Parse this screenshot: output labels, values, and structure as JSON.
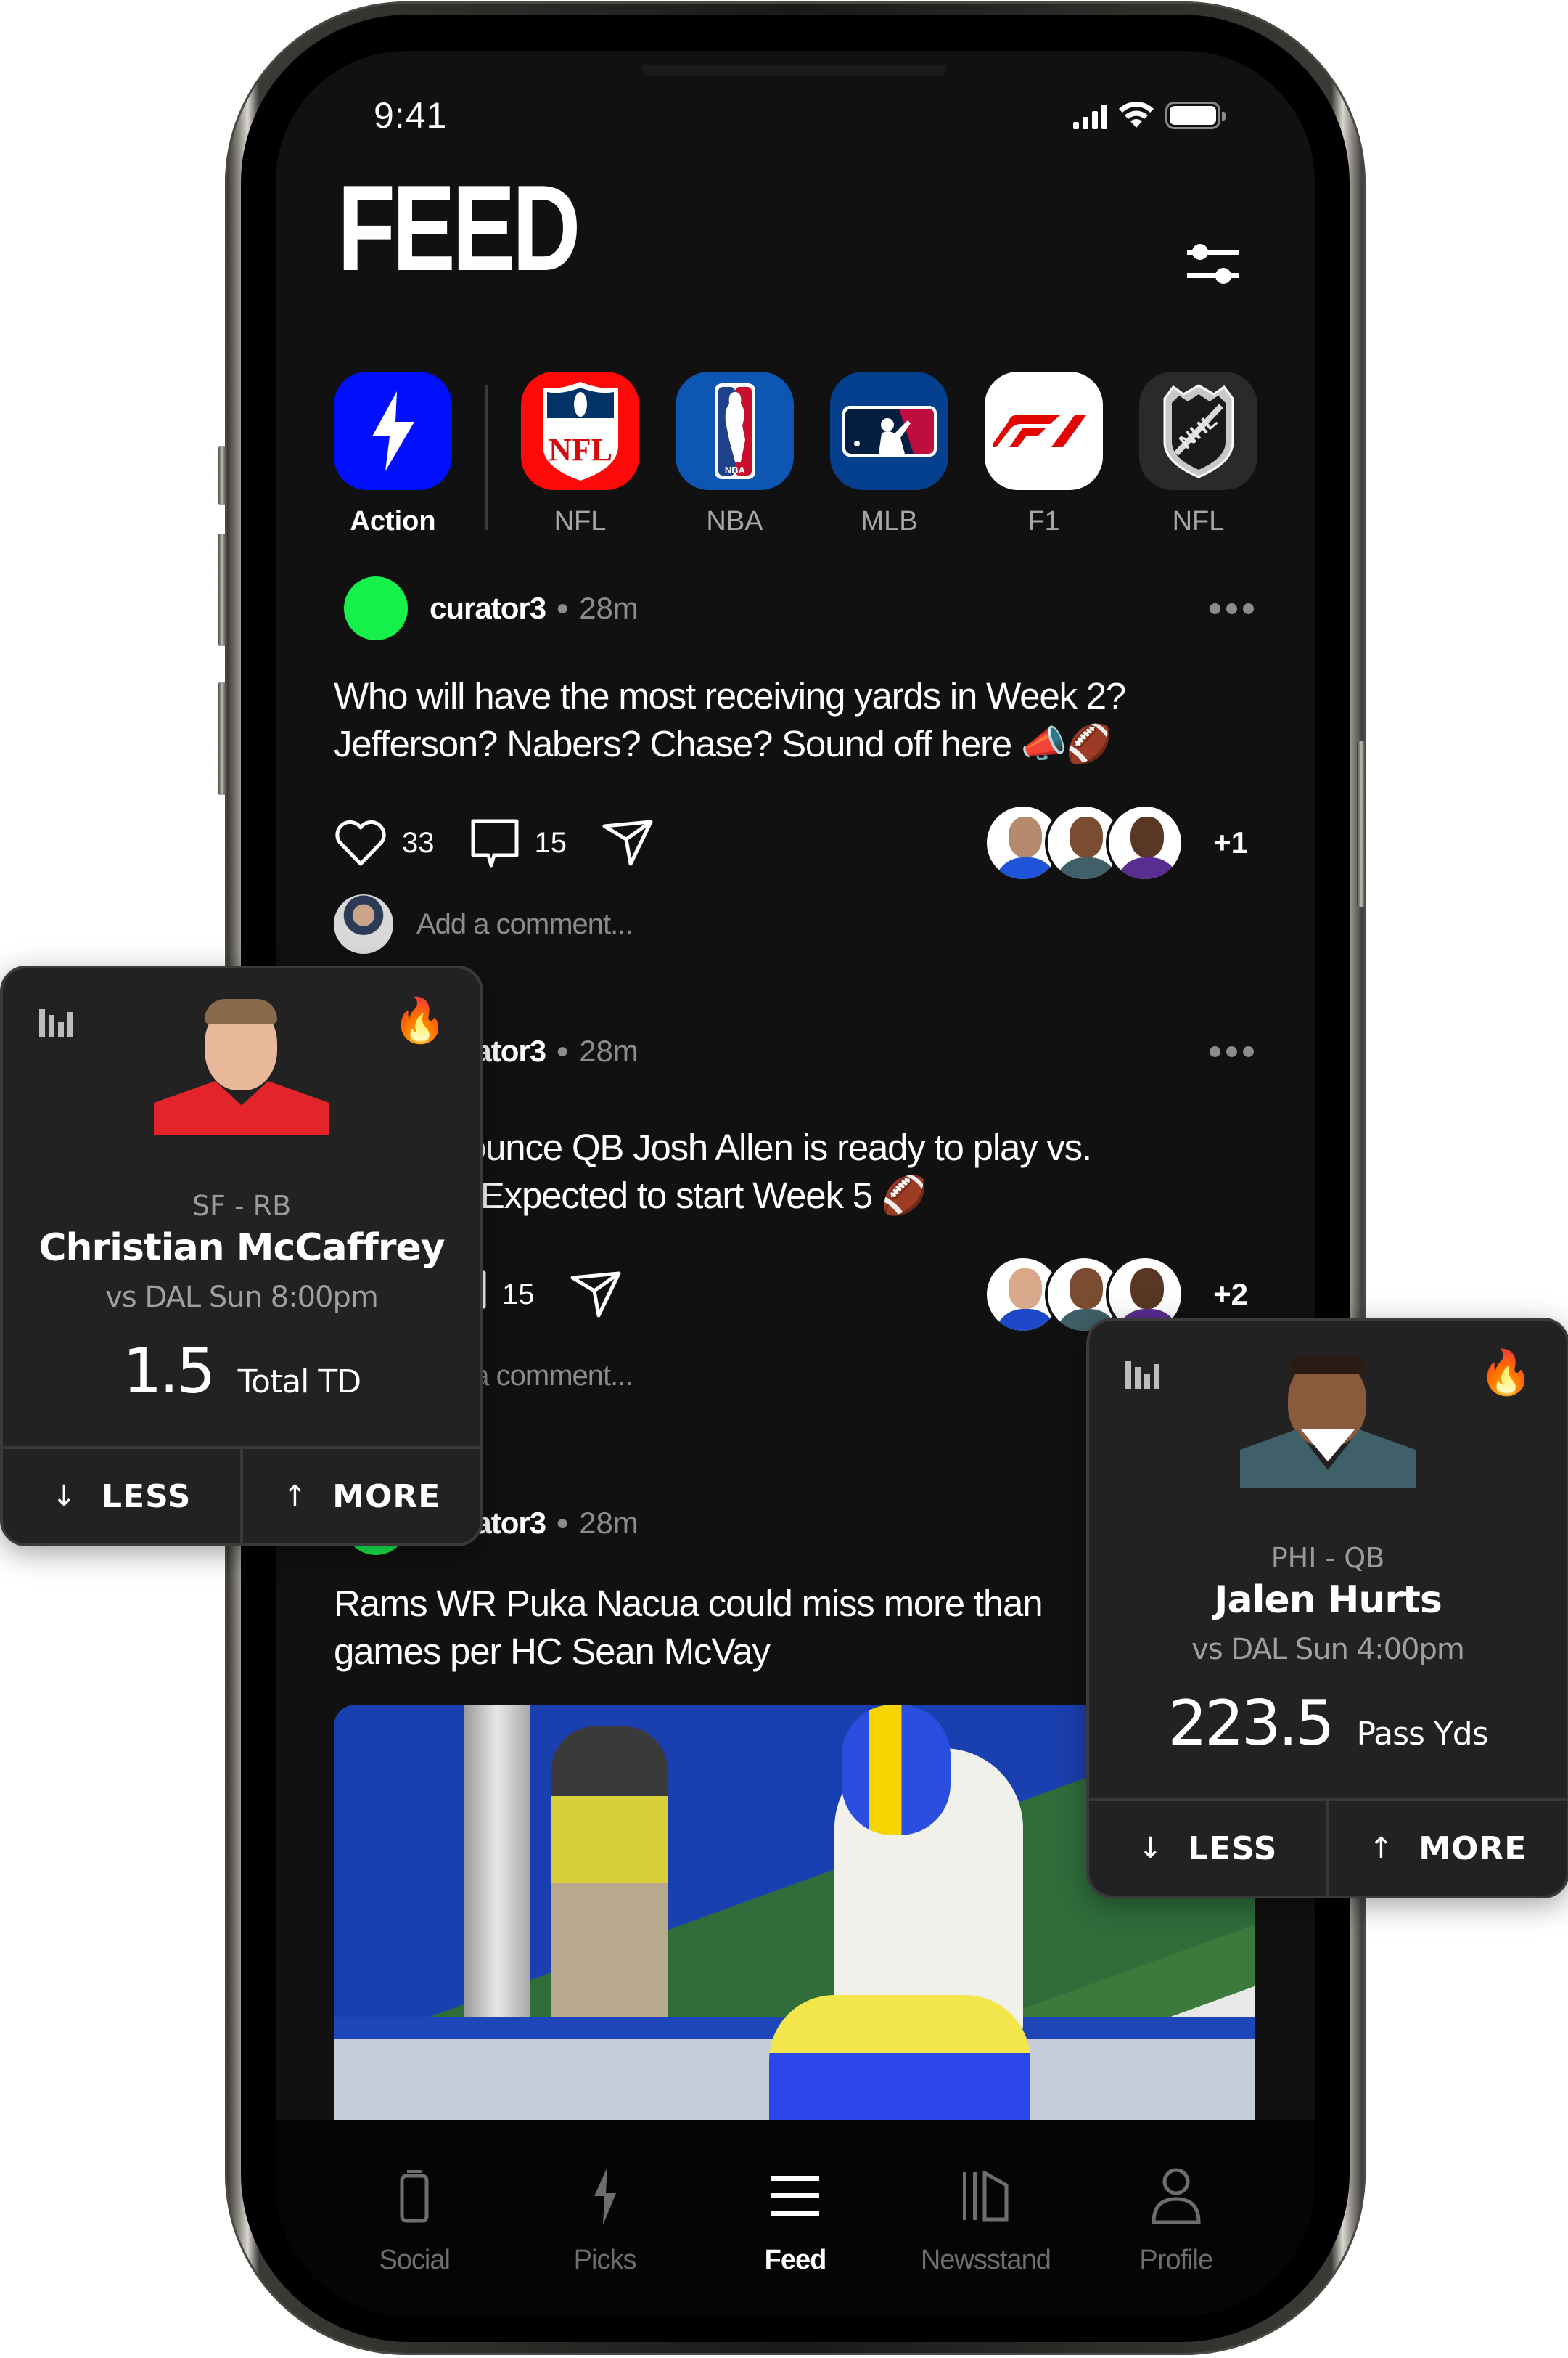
{
  "status_bar": {
    "time": "9:41"
  },
  "header": {
    "title": "FEED",
    "filter_icon": "sliders-icon"
  },
  "leagues": [
    {
      "label": "Action",
      "icon": "lightning-icon",
      "active": true,
      "color": "#0010ff"
    },
    {
      "label": "NFL",
      "icon": "nfl-shield-icon",
      "color": "#e8001c"
    },
    {
      "label": "NBA",
      "icon": "nba-logo-icon",
      "color": "#0d56b3"
    },
    {
      "label": "MLB",
      "icon": "mlb-logo-icon",
      "color": "#05408f"
    },
    {
      "label": "F1",
      "icon": "f1-logo-icon",
      "color": "#ffffff"
    },
    {
      "label": "NFL",
      "icon": "nhl-shield-icon",
      "color": "#2a2a2a"
    }
  ],
  "posts": [
    {
      "user": "curator3",
      "time": "28m",
      "text": "Who will have the most receiving yards in Week 2? Jefferson? Nabers? Chase? Sound off here 📣🏈",
      "likes": "33",
      "comments": "15",
      "faces_more": "+1",
      "comment_placeholder": "Add a comment..."
    },
    {
      "user": "curator3",
      "time": "28m",
      "text": "Bills announce QB Josh Allen is ready to play vs. Bengals. Expected to start Week 5 🏈",
      "likes": "",
      "comments": "15",
      "faces_more": "+2",
      "comment_placeholder": "Add a comment..."
    },
    {
      "user": "curator3",
      "time": "28m",
      "text": "Rams WR Puka Nacua could miss more than games per HC Sean McVay"
    }
  ],
  "tabbar": [
    {
      "label": "Social",
      "icon": "phone-icon"
    },
    {
      "label": "Picks",
      "icon": "lightning-icon"
    },
    {
      "label": "Feed",
      "icon": "menu-icon",
      "active": true
    },
    {
      "label": "Newsstand",
      "icon": "newsstand-icon"
    },
    {
      "label": "Profile",
      "icon": "person-icon"
    }
  ],
  "prop_cards": [
    {
      "team_pos": "SF - RB",
      "name": "Christian McCaffrey",
      "game": "vs DAL Sun 8:00pm",
      "line": "1.5",
      "stat": "Total TD",
      "jersey_color": "#e3242b",
      "less_label": "LESS",
      "more_label": "MORE"
    },
    {
      "team_pos": "PHI - QB",
      "name": "Jalen Hurts",
      "game": "vs DAL Sun 4:00pm",
      "line": "223.5",
      "stat": "Pass Yds",
      "jersey_color": "#3f6068",
      "less_label": "LESS",
      "more_label": "MORE"
    }
  ],
  "colors": {
    "accent_green": "#16f04b",
    "action_blue": "#0010ff",
    "background": "#111111",
    "card": "#222222"
  }
}
